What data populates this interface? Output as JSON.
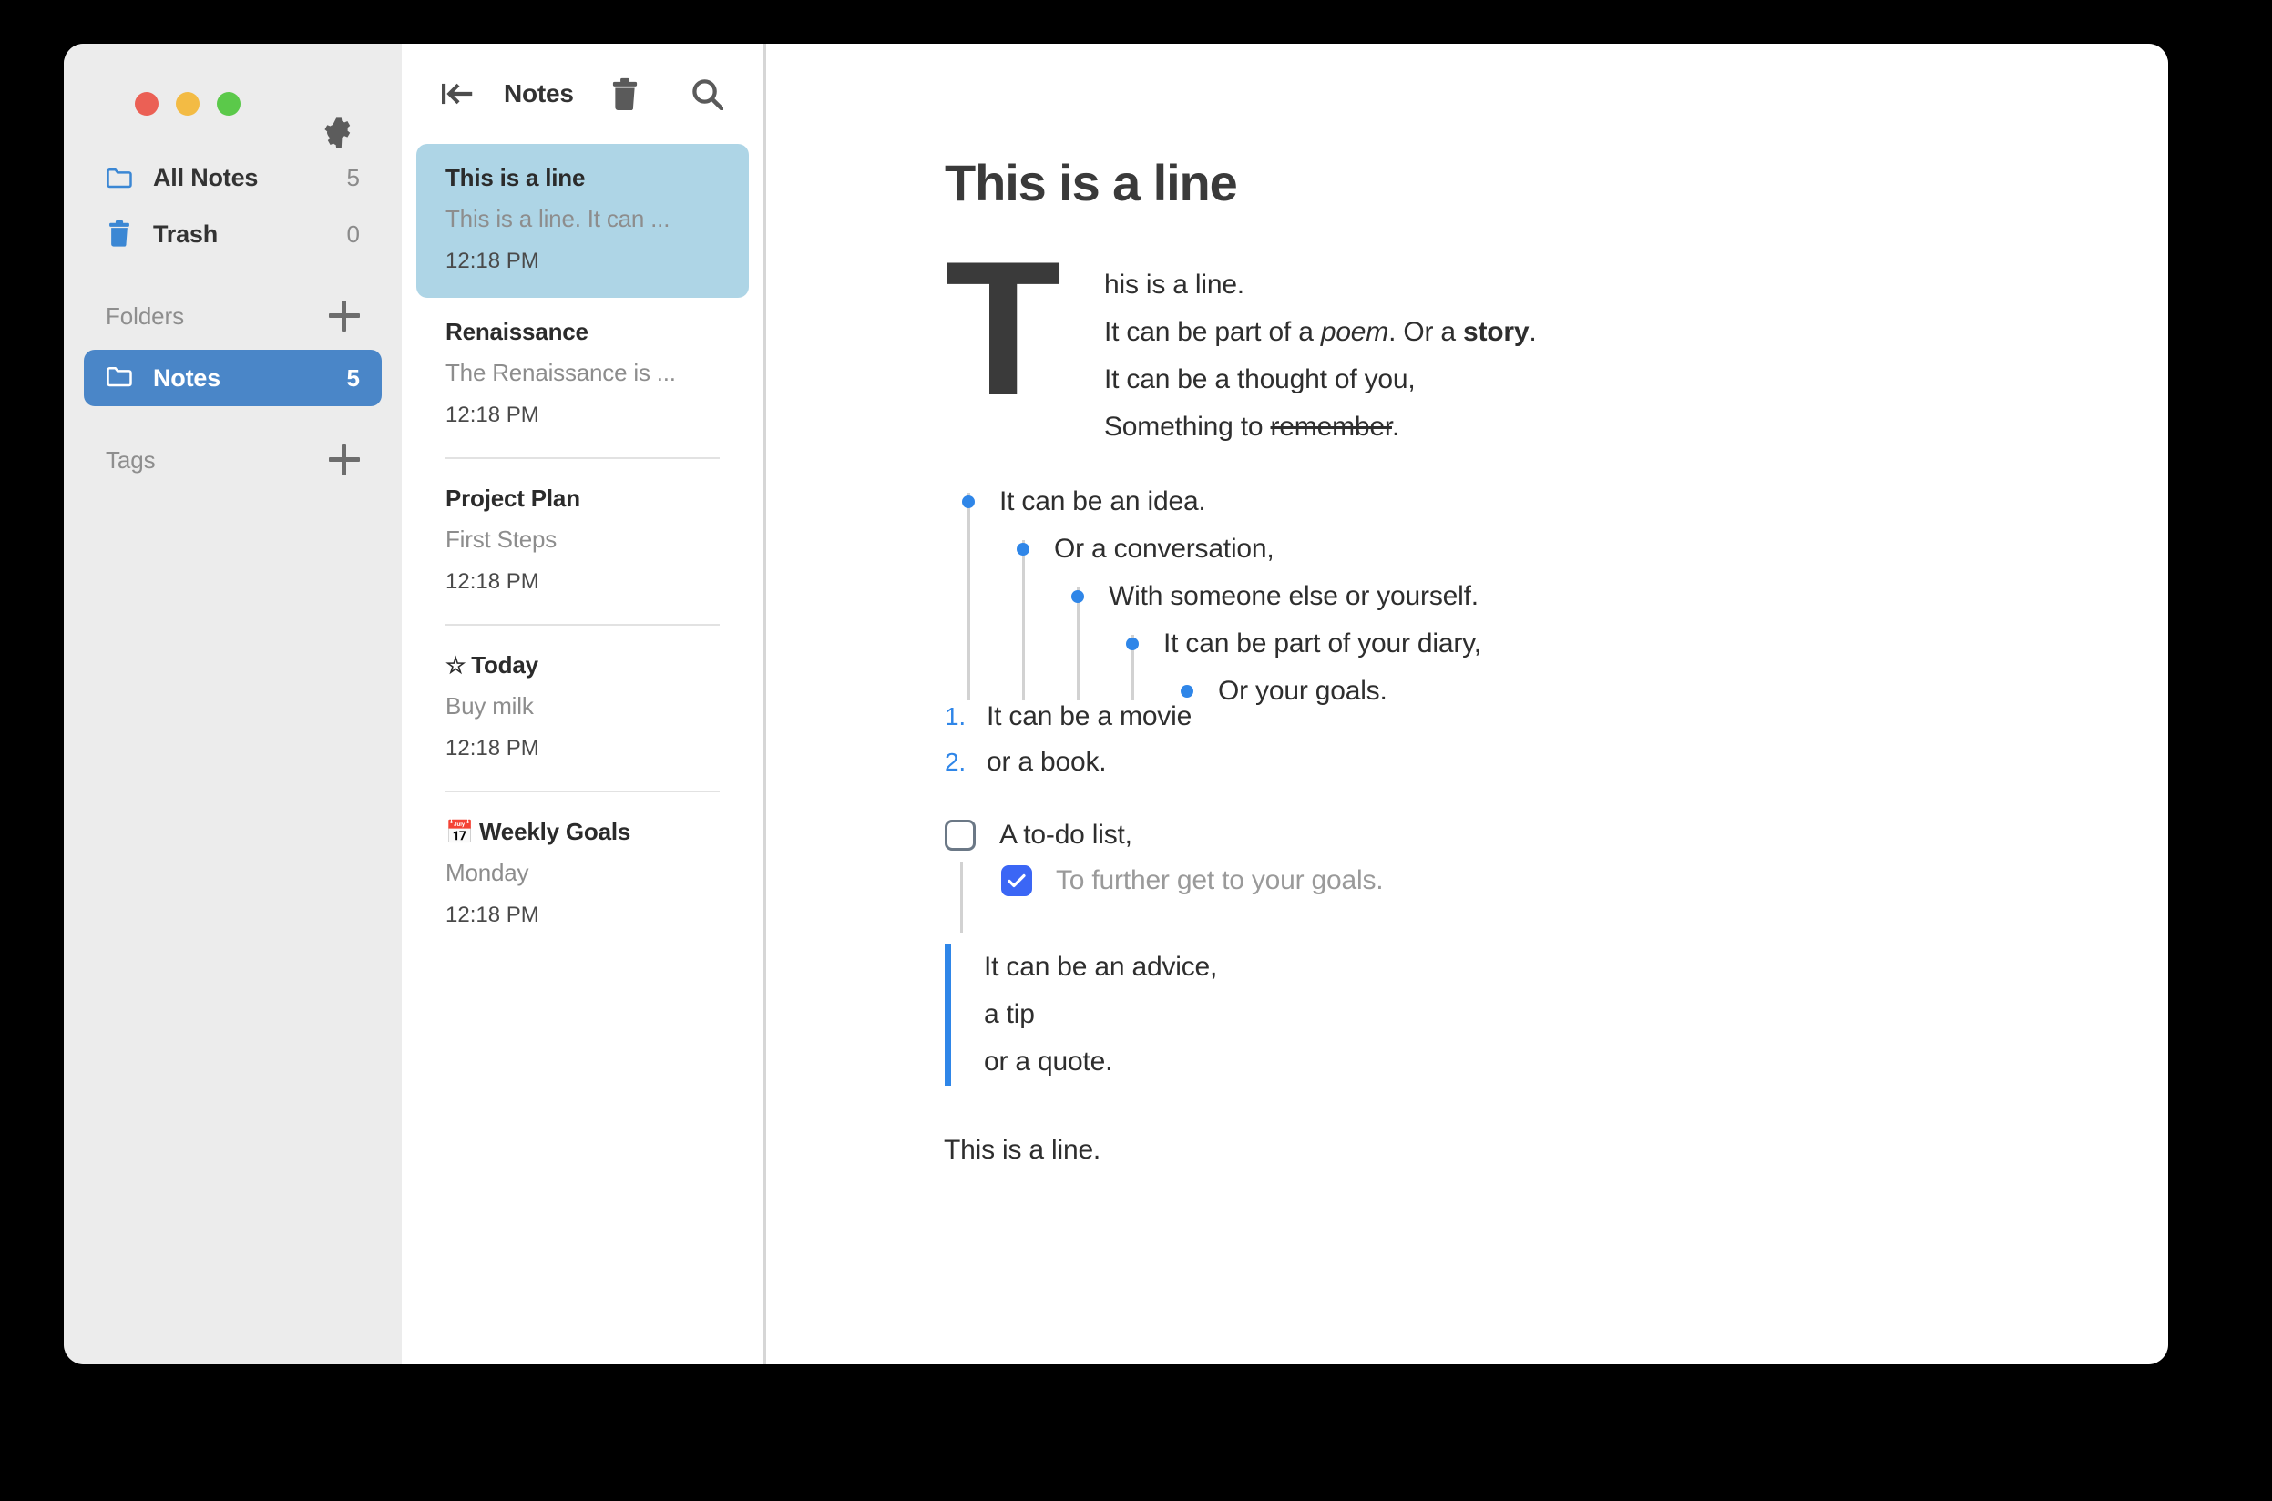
{
  "window": {
    "traffic_lights": [
      "close",
      "minimize",
      "maximize"
    ]
  },
  "sidebar": {
    "gear_icon": "gear-icon",
    "nav": [
      {
        "icon": "folder-icon",
        "label": "All Notes",
        "count": "5"
      },
      {
        "icon": "trash-icon",
        "label": "Trash",
        "count": "0"
      }
    ],
    "sections": [
      {
        "title": "Folders",
        "add_icon": "plus-icon"
      },
      {
        "title": "Tags",
        "add_icon": "plus-icon"
      }
    ],
    "folders": [
      {
        "icon": "folder-icon",
        "label": "Notes",
        "count": "5",
        "selected": true
      }
    ],
    "tags": []
  },
  "notelist": {
    "toolbar": {
      "collapse_icon": "collapse-sidebar-icon",
      "title": "Notes",
      "trash_icon": "trash-icon",
      "search_icon": "search-icon"
    },
    "notes": [
      {
        "emoji": "",
        "title": "This is a line",
        "preview": "This is a line. It can ...",
        "time": "12:18 PM",
        "selected": true
      },
      {
        "emoji": "",
        "title": "Renaissance",
        "preview": "The Renaissance is ...",
        "time": "12:18 PM",
        "selected": false
      },
      {
        "emoji": "",
        "title": "Project Plan",
        "preview": "First Steps",
        "time": "12:18 PM",
        "selected": false
      },
      {
        "emoji": "☆",
        "title": "Today",
        "preview": "Buy milk",
        "time": "12:18 PM",
        "selected": false
      },
      {
        "emoji": "📅",
        "title": "Weekly Goals",
        "preview": "Monday",
        "time": "12:18 PM",
        "selected": false
      }
    ]
  },
  "editor": {
    "title": "This is a line",
    "dropcap": "T",
    "intro_lines": {
      "line1": "his is a line.",
      "line2_a": "It can be part of a ",
      "line2_em": "poem",
      "line2_b": ". Or a ",
      "line2_strong": "story",
      "line2_c": ".",
      "line3": "It can be a thought of you,",
      "line4_a": "Something to ",
      "line4_strike": "remember",
      "line4_b": "."
    },
    "bullets": [
      {
        "level": 0,
        "text": "It can be an idea."
      },
      {
        "level": 1,
        "text": "Or a conversation,"
      },
      {
        "level": 2,
        "text": "With someone else or yourself."
      },
      {
        "level": 3,
        "text": "It can be part of your diary,"
      },
      {
        "level": 4,
        "text": "Or your goals."
      }
    ],
    "ordered": [
      {
        "num": "1.",
        "text": "It can be a movie"
      },
      {
        "num": "2.",
        "text": "or a book."
      }
    ],
    "todos": [
      {
        "checked": false,
        "text": "A to-do list,",
        "child": false
      },
      {
        "checked": true,
        "text": "To further get to your goals.",
        "child": true
      }
    ],
    "quote": [
      "It can be an advice,",
      "a tip",
      "or a quote."
    ],
    "closing": "This is a line."
  },
  "colors": {
    "accent_blue": "#2f86e8",
    "folder_selected": "#4a86c8",
    "note_selected": "#aed5e6",
    "checkbox_checked": "#3b66f5",
    "sidebar_bg": "#ececec"
  }
}
